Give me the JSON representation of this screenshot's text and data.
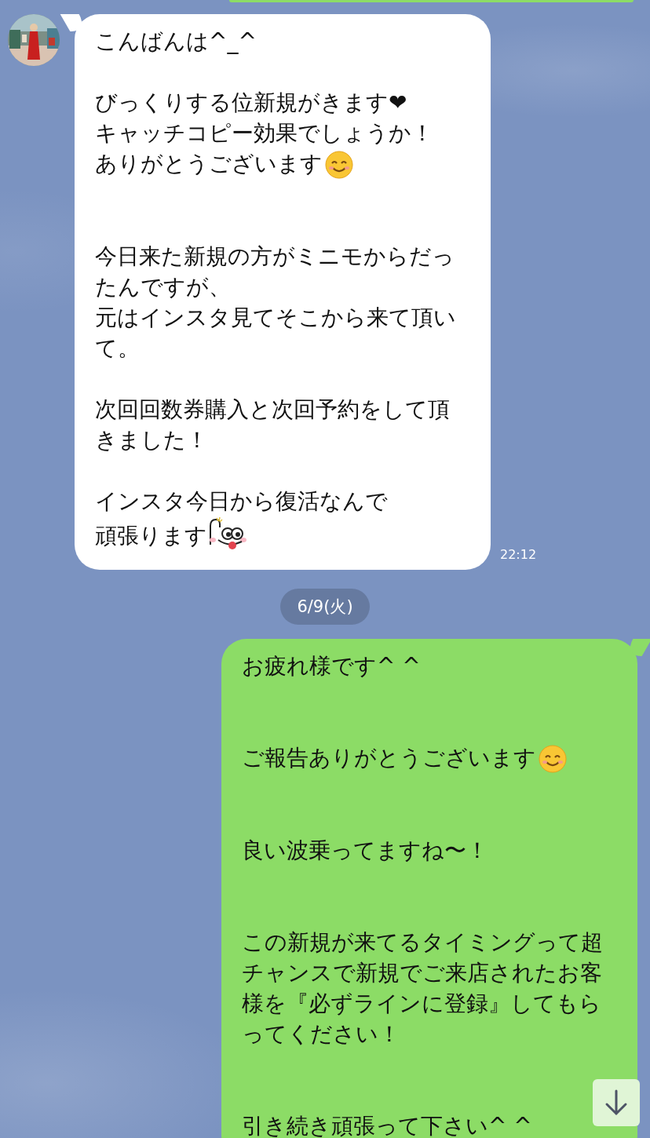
{
  "messages": [
    {
      "kind": "outgoing",
      "cut": true
    },
    {
      "kind": "incoming",
      "time": "22:12",
      "paragraphs": [
        {
          "kind": "first",
          "lines": [
            {
              "kind": "text",
              "text": "こんばんは^_^"
            }
          ]
        },
        {
          "kind": "after-blank",
          "lines": [
            {
              "kind": "text",
              "text": "びっくりする位新規がきます❤"
            },
            {
              "kind": "text",
              "text": "キャッチコピー効果でしょうか！"
            },
            {
              "kind": "smile",
              "text": "ありがとうございます"
            }
          ]
        },
        {
          "kind": "after-two-blanks",
          "lines": [
            {
              "kind": "text",
              "text": "今日来た新規の方がミニモからだっ"
            },
            {
              "kind": "text",
              "text": "たんですが、"
            },
            {
              "kind": "text",
              "text": "元はインスタ見てそこから来て頂い"
            },
            {
              "kind": "text",
              "text": "て。"
            }
          ]
        },
        {
          "kind": "after-blank",
          "lines": [
            {
              "kind": "text",
              "text": "次回回数券購入と次回予約をして頂"
            },
            {
              "kind": "text",
              "text": "きました！"
            }
          ]
        },
        {
          "kind": "after-blank",
          "lines": [
            {
              "kind": "text",
              "text": "インスタ今日から復活なんで"
            },
            {
              "kind": "sticker",
              "text": "頑張ります"
            }
          ]
        }
      ]
    },
    {
      "kind": "date",
      "label": "6/9(火)"
    },
    {
      "kind": "outgoing",
      "cut": false,
      "paragraphs": [
        {
          "kind": "first",
          "lines": [
            {
              "kind": "text",
              "text": "お疲れ様です^ ^"
            }
          ]
        },
        {
          "kind": "after-two-blanks",
          "lines": [
            {
              "kind": "smile",
              "text": "ご報告ありがとうございます"
            }
          ]
        },
        {
          "kind": "after-two-blanks",
          "lines": [
            {
              "kind": "text",
              "text": "良い波乗ってますね〜！"
            }
          ]
        },
        {
          "kind": "after-two-blanks",
          "lines": [
            {
              "kind": "text",
              "text": "この新規が来てるタイミングって超"
            },
            {
              "kind": "text",
              "text": "チャンスで新規でご来店されたお客"
            },
            {
              "kind": "text",
              "text": "様を『必ずラインに登録』してもら"
            },
            {
              "kind": "text",
              "text": "ってください！"
            }
          ]
        },
        {
          "kind": "after-two-blanks",
          "lines": [
            {
              "kind": "text",
              "text": "引き続き頑張って下さい^ ^"
            }
          ]
        }
      ]
    }
  ],
  "scroll_button": {
    "kind": "down"
  }
}
